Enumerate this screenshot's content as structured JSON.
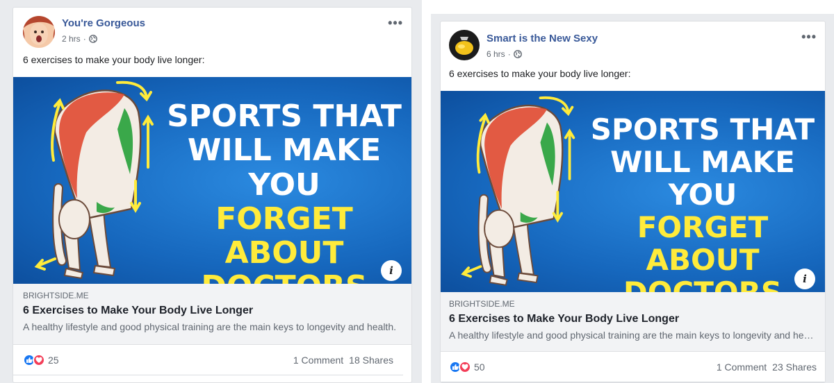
{
  "colors": {
    "link_blue": "#385898",
    "meta_grey": "#606770",
    "hero_blue": "#1a73c8",
    "hero_yellow": "#ffeb3b",
    "like_blue": "#1877f2",
    "love_red": "#f33e58"
  },
  "posts": [
    {
      "page_name": "You're Gorgeous",
      "time": "2 hrs",
      "privacy_icon": "globe-icon",
      "more_label": "•••",
      "caption": "6 exercises to make your body live longer:",
      "hero": {
        "line1": "SPORTS THAT",
        "line2": "WILL MAKE YOU",
        "line3": "FORGET ABOUT",
        "line4": "DOCTORS",
        "info_label": "i"
      },
      "link": {
        "domain": "BRIGHTSIDE.ME",
        "title": "6 Exercises to Make Your Body Live Longer",
        "description": "A healthy lifestyle and good physical training are the main keys to longevity and health."
      },
      "stats": {
        "reaction_count": "25",
        "comments": "1 Comment",
        "shares": "18 Shares"
      }
    },
    {
      "page_name": "Smart is the New Sexy",
      "time": "6 hrs",
      "privacy_icon": "globe-icon",
      "more_label": "•••",
      "caption": "6 exercises to make your body live longer:",
      "hero": {
        "line1": "SPORTS THAT",
        "line2": "WILL MAKE YOU",
        "line3": "FORGET ABOUT",
        "line4": "DOCTORS",
        "info_label": "i"
      },
      "link": {
        "domain": "BRIGHTSIDE.ME",
        "title": "6 Exercises to Make Your Body Live Longer",
        "description": "A healthy lifestyle and good physical training are the main keys to longevity and health."
      },
      "stats": {
        "reaction_count": "50",
        "comments": "1 Comment",
        "shares": "23 Shares"
      }
    }
  ]
}
